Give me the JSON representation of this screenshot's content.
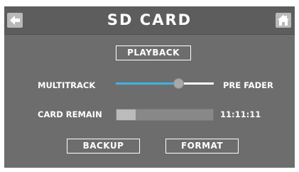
{
  "header": {
    "title": "SD CARD",
    "back_icon": "arrow-left-icon",
    "home_icon": "home-icon"
  },
  "playback_button": {
    "label": "PLAYBACK"
  },
  "source_slider": {
    "left_label": "MULTITRACK",
    "right_label": "PRE FADER",
    "level": 0.64,
    "fill_color": "#3db4e4"
  },
  "card_remain": {
    "label": "CARD REMAIN",
    "used_fraction": 0.2,
    "time": "11:11:11"
  },
  "actions": {
    "backup_label": "BACKUP",
    "format_label": "FORMAT"
  },
  "colors": {
    "background": "#6d6d6d",
    "title_bar": "#5d5d5d",
    "text": "#ffffff",
    "accent": "#3db4e4"
  }
}
